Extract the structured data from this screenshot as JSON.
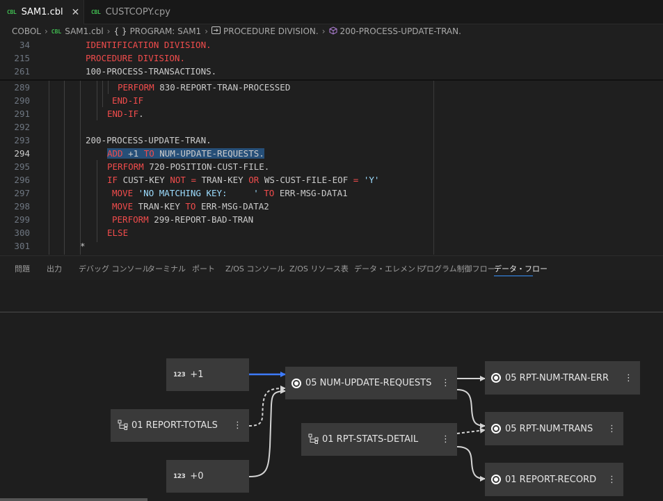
{
  "tabs": [
    {
      "lang": "CBL",
      "label": "SAM1.cbl",
      "close": "✕"
    },
    {
      "lang": "CBL",
      "label": "CUSTCOPY.cpy"
    }
  ],
  "breadcrumb": {
    "root": "COBOL",
    "file_lang": "CBL",
    "file": "SAM1.cbl",
    "program_icon": "{ }",
    "program": "PROGRAM: SAM1",
    "division": "PROCEDURE DIVISION.",
    "section": "200-PROCESS-UPDATE-TRAN."
  },
  "sticky_lines": [
    {
      "n": "34",
      "text": "IDENTIFICATION DIVISION."
    },
    {
      "n": "215",
      "text": "PROCEDURE DIVISION."
    },
    {
      "n": "261",
      "text": "100-PROCESS-TRANSACTIONS."
    }
  ],
  "code_lines": [
    {
      "n": "289",
      "a": "PERFORM",
      "b": " 830-REPORT-TRAN-PROCESSED"
    },
    {
      "n": "290",
      "a": "END-IF"
    },
    {
      "n": "291",
      "a": "END-IF",
      "b": "."
    },
    {
      "n": "292"
    },
    {
      "n": "293",
      "b": "200-PROCESS-UPDATE-TRAN."
    },
    {
      "n": "294",
      "a": "ADD",
      "b": " +1 ",
      "c": "TO",
      "d": " NUM-UPDATE-REQUESTS."
    },
    {
      "n": "295",
      "a": "PERFORM",
      "b": " 720-POSITION-CUST-FILE."
    },
    {
      "n": "296",
      "a": "IF",
      "b": " CUST-KEY ",
      "c": "NOT",
      "d": " ",
      "e": "=",
      "f": " TRAN-KEY ",
      "g": "OR",
      "h": " WS-CUST-FILE-EOF ",
      "i": "=",
      "j": " ",
      "k": "'Y'"
    },
    {
      "n": "297",
      "a": "MOVE",
      "b": " ",
      "c": "'NO MATCHING KEY:     '",
      "d": " ",
      "e": "TO",
      "f": " ERR-MSG-DATA1"
    },
    {
      "n": "298",
      "a": "MOVE",
      "b": " TRAN-KEY ",
      "c": "TO",
      "d": " ERR-MSG-DATA2"
    },
    {
      "n": "299",
      "a": "PERFORM",
      "b": " 299-REPORT-BAD-TRAN"
    },
    {
      "n": "300",
      "a": "ELSE"
    },
    {
      "n": "301",
      "b": "*"
    }
  ],
  "panel_tabs": [
    "問題",
    "出力",
    "デバッグ コンソール",
    "ターミナル",
    "ポート",
    "Z/OS コンソール",
    "Z/OS リソース表",
    "データ・エレメント",
    "プログラム制御フロー",
    "データ・フロー"
  ],
  "flow_nodes": {
    "plus1": {
      "icon": "123",
      "label": "+1"
    },
    "plus0": {
      "icon": "123",
      "label": "+0"
    },
    "report_totals": {
      "label": "01 REPORT-TOTALS"
    },
    "num_update": {
      "label": "05 NUM-UPDATE-REQUESTS"
    },
    "stats_detail": {
      "label": "01 RPT-STATS-DETAIL"
    },
    "tran_err": {
      "label": "05 RPT-NUM-TRAN-ERR"
    },
    "num_trans": {
      "label": "05 RPT-NUM-TRANS"
    },
    "report_record": {
      "label": "01 REPORT-RECORD"
    },
    "menu_glyph": "⋮"
  },
  "colors": {
    "keyword": "#f14c4c",
    "string": "#9cdcfe",
    "highlight_edge": "#3d7bff",
    "accent": "#3794ff"
  }
}
